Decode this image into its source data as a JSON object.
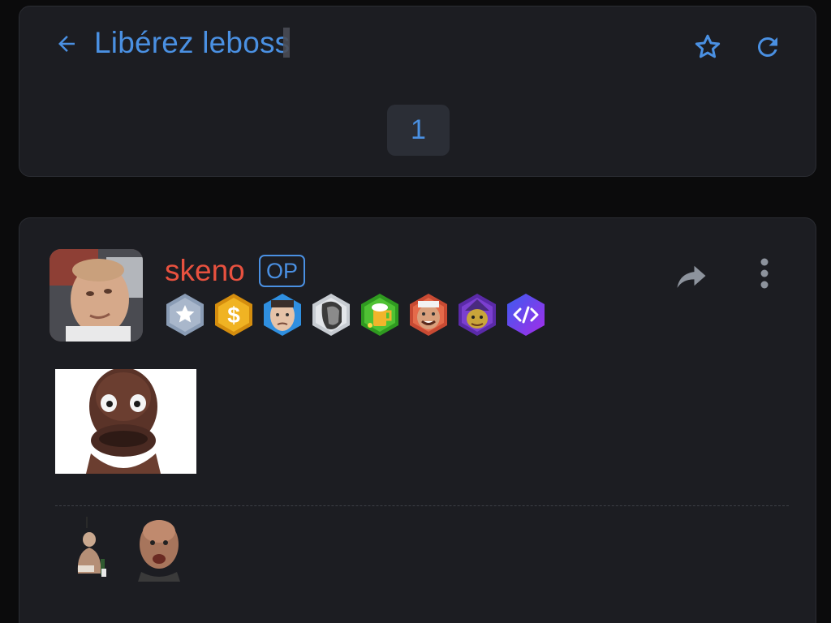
{
  "topic": {
    "title": "Libérez leboss",
    "pagination": {
      "current_page": "1"
    }
  },
  "post": {
    "author": {
      "username": "skeno",
      "op_label": "OP",
      "username_color": "#e8513f"
    },
    "badges": [
      {
        "name": "star-badge",
        "color": "#8a9cb5"
      },
      {
        "name": "dollar-badge",
        "color": "#e6a817"
      },
      {
        "name": "face-badge",
        "color": "#2f8fe0"
      },
      {
        "name": "gigachad-badge",
        "color": "#9aa3ad"
      },
      {
        "name": "beer-badge",
        "color": "#3fae2a"
      },
      {
        "name": "risitas-badge",
        "color": "#d9563a"
      },
      {
        "name": "wizard-badge",
        "color": "#7b3fd0"
      },
      {
        "name": "code-badge",
        "color": "#7a3cf0"
      }
    ],
    "stickers": [
      "figure-sticker",
      "bald-man-sticker"
    ]
  },
  "colors": {
    "accent": "#4a90e2",
    "card_bg": "#1c1d22",
    "page_bg": "#0b0b0c"
  }
}
